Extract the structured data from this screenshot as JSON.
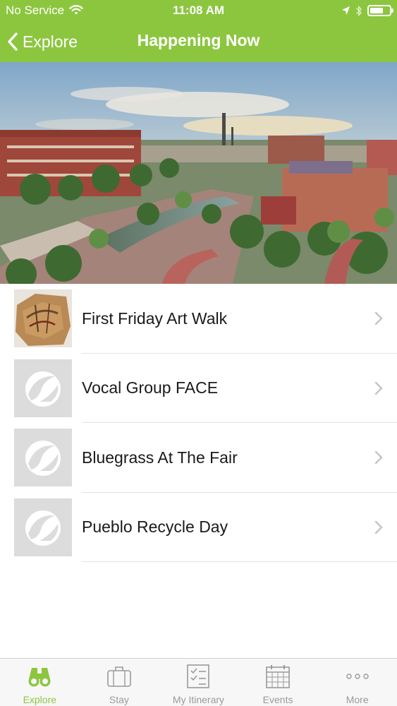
{
  "status_bar": {
    "carrier": "No Service",
    "time": "11:08 AM",
    "battery_level": 0.7
  },
  "nav": {
    "back_label": "Explore",
    "title": "Happening Now"
  },
  "events": [
    {
      "title": "First Friday Art Walk",
      "thumbnail": "art-thumbnail"
    },
    {
      "title": "Vocal Group FACE",
      "thumbnail": "placeholder-logo"
    },
    {
      "title": "Bluegrass At The Fair",
      "thumbnail": "placeholder-logo"
    },
    {
      "title": "Pueblo Recycle Day",
      "thumbnail": "placeholder-logo"
    }
  ],
  "tabs": [
    {
      "label": "Explore",
      "icon": "binoculars-icon",
      "active": true
    },
    {
      "label": "Stay",
      "icon": "suitcase-icon",
      "active": false
    },
    {
      "label": "My Itinerary",
      "icon": "checklist-icon",
      "active": false
    },
    {
      "label": "Events",
      "icon": "calendar-icon",
      "active": false
    },
    {
      "label": "More",
      "icon": "more-dots-icon",
      "active": false
    }
  ],
  "colors": {
    "accent": "#8cc63f",
    "tab_inactive": "#9a9a9a",
    "placeholder_bg": "#dcdcdc"
  }
}
